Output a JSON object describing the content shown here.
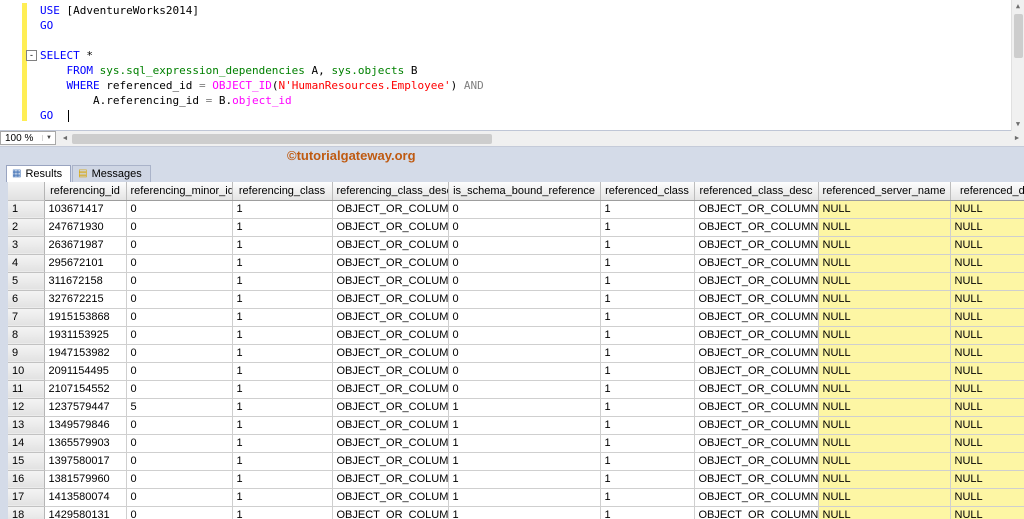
{
  "editor": {
    "lines": [
      {
        "tokens": [
          {
            "c": "kw",
            "t": "USE"
          },
          {
            "c": "pl",
            "t": " [AdventureWorks2014]"
          }
        ]
      },
      {
        "tokens": [
          {
            "c": "kw",
            "t": "GO"
          }
        ]
      },
      {
        "tokens": []
      },
      {
        "collapse": true,
        "tokens": [
          {
            "c": "kw",
            "t": "SELECT"
          },
          {
            "c": "pl",
            "t": " *"
          }
        ]
      },
      {
        "tokens": [
          {
            "c": "pl",
            "t": "    "
          },
          {
            "c": "kw",
            "t": "FROM"
          },
          {
            "c": "pl",
            "t": " "
          },
          {
            "c": "sys",
            "t": "sys.sql_expression_dependencies"
          },
          {
            "c": "pl",
            "t": " A, "
          },
          {
            "c": "sys",
            "t": "sys.objects"
          },
          {
            "c": "pl",
            "t": " B"
          }
        ]
      },
      {
        "tokens": [
          {
            "c": "pl",
            "t": "    "
          },
          {
            "c": "kw",
            "t": "WHERE"
          },
          {
            "c": "pl",
            "t": " referenced_id "
          },
          {
            "c": "op",
            "t": "="
          },
          {
            "c": "pl",
            "t": " "
          },
          {
            "c": "fn",
            "t": "OBJECT_ID"
          },
          {
            "c": "pl",
            "t": "("
          },
          {
            "c": "str",
            "t": "N'HumanResources.Employee'"
          },
          {
            "c": "pl",
            "t": ") "
          },
          {
            "c": "op",
            "t": "AND"
          }
        ]
      },
      {
        "tokens": [
          {
            "c": "pl",
            "t": "        A.referencing_id "
          },
          {
            "c": "op",
            "t": "="
          },
          {
            "c": "pl",
            "t": " B."
          },
          {
            "c": "fn",
            "t": "object_id"
          }
        ]
      },
      {
        "caret": true,
        "tokens": [
          {
            "c": "kw",
            "t": "GO"
          },
          {
            "c": "pl",
            "t": "  "
          }
        ]
      }
    ]
  },
  "zoom": {
    "value": "100 %"
  },
  "watermark": "©tutorialgateway.org",
  "tabs": [
    {
      "label": "Results"
    },
    {
      "label": "Messages"
    }
  ],
  "grid": {
    "columns": [
      "referencing_id",
      "referencing_minor_id",
      "referencing_class",
      "referencing_class_desc",
      "is_schema_bound_reference",
      "referenced_class",
      "referenced_class_desc",
      "referenced_server_name",
      "referenced_data"
    ],
    "rows": [
      [
        "103671417",
        "0",
        "1",
        "OBJECT_OR_COLUMN",
        "0",
        "1",
        "OBJECT_OR_COLUMN",
        "NULL",
        "NULL"
      ],
      [
        "247671930",
        "0",
        "1",
        "OBJECT_OR_COLUMN",
        "0",
        "1",
        "OBJECT_OR_COLUMN",
        "NULL",
        "NULL"
      ],
      [
        "263671987",
        "0",
        "1",
        "OBJECT_OR_COLUMN",
        "0",
        "1",
        "OBJECT_OR_COLUMN",
        "NULL",
        "NULL"
      ],
      [
        "295672101",
        "0",
        "1",
        "OBJECT_OR_COLUMN",
        "0",
        "1",
        "OBJECT_OR_COLUMN",
        "NULL",
        "NULL"
      ],
      [
        "311672158",
        "0",
        "1",
        "OBJECT_OR_COLUMN",
        "0",
        "1",
        "OBJECT_OR_COLUMN",
        "NULL",
        "NULL"
      ],
      [
        "327672215",
        "0",
        "1",
        "OBJECT_OR_COLUMN",
        "0",
        "1",
        "OBJECT_OR_COLUMN",
        "NULL",
        "NULL"
      ],
      [
        "1915153868",
        "0",
        "1",
        "OBJECT_OR_COLUMN",
        "0",
        "1",
        "OBJECT_OR_COLUMN",
        "NULL",
        "NULL"
      ],
      [
        "1931153925",
        "0",
        "1",
        "OBJECT_OR_COLUMN",
        "0",
        "1",
        "OBJECT_OR_COLUMN",
        "NULL",
        "NULL"
      ],
      [
        "1947153982",
        "0",
        "1",
        "OBJECT_OR_COLUMN",
        "0",
        "1",
        "OBJECT_OR_COLUMN",
        "NULL",
        "NULL"
      ],
      [
        "2091154495",
        "0",
        "1",
        "OBJECT_OR_COLUMN",
        "0",
        "1",
        "OBJECT_OR_COLUMN",
        "NULL",
        "NULL"
      ],
      [
        "2107154552",
        "0",
        "1",
        "OBJECT_OR_COLUMN",
        "0",
        "1",
        "OBJECT_OR_COLUMN",
        "NULL",
        "NULL"
      ],
      [
        "1237579447",
        "5",
        "1",
        "OBJECT_OR_COLUMN",
        "1",
        "1",
        "OBJECT_OR_COLUMN",
        "NULL",
        "NULL"
      ],
      [
        "1349579846",
        "0",
        "1",
        "OBJECT_OR_COLUMN",
        "1",
        "1",
        "OBJECT_OR_COLUMN",
        "NULL",
        "NULL"
      ],
      [
        "1365579903",
        "0",
        "1",
        "OBJECT_OR_COLUMN",
        "1",
        "1",
        "OBJECT_OR_COLUMN",
        "NULL",
        "NULL"
      ],
      [
        "1397580017",
        "0",
        "1",
        "OBJECT_OR_COLUMN",
        "1",
        "1",
        "OBJECT_OR_COLUMN",
        "NULL",
        "NULL"
      ],
      [
        "1381579960",
        "0",
        "1",
        "OBJECT_OR_COLUMN",
        "1",
        "1",
        "OBJECT_OR_COLUMN",
        "NULL",
        "NULL"
      ],
      [
        "1413580074",
        "0",
        "1",
        "OBJECT_OR_COLUMN",
        "1",
        "1",
        "OBJECT_OR_COLUMN",
        "NULL",
        "NULL"
      ],
      [
        "1429580131",
        "0",
        "1",
        "OBJECT_OR_COLUMN",
        "1",
        "1",
        "OBJECT_OR_COLUMN",
        "NULL",
        "NULL"
      ]
    ]
  },
  "colors": {
    "keyword": "#0000ff",
    "string": "#ff0000",
    "function": "#ff00ff",
    "system_object": "#008000",
    "operator": "#808080",
    "watermark_text": "#bf5a11",
    "null_cell_bg": "#fdf6a4",
    "change_tracking_bar": "#ffee54"
  }
}
